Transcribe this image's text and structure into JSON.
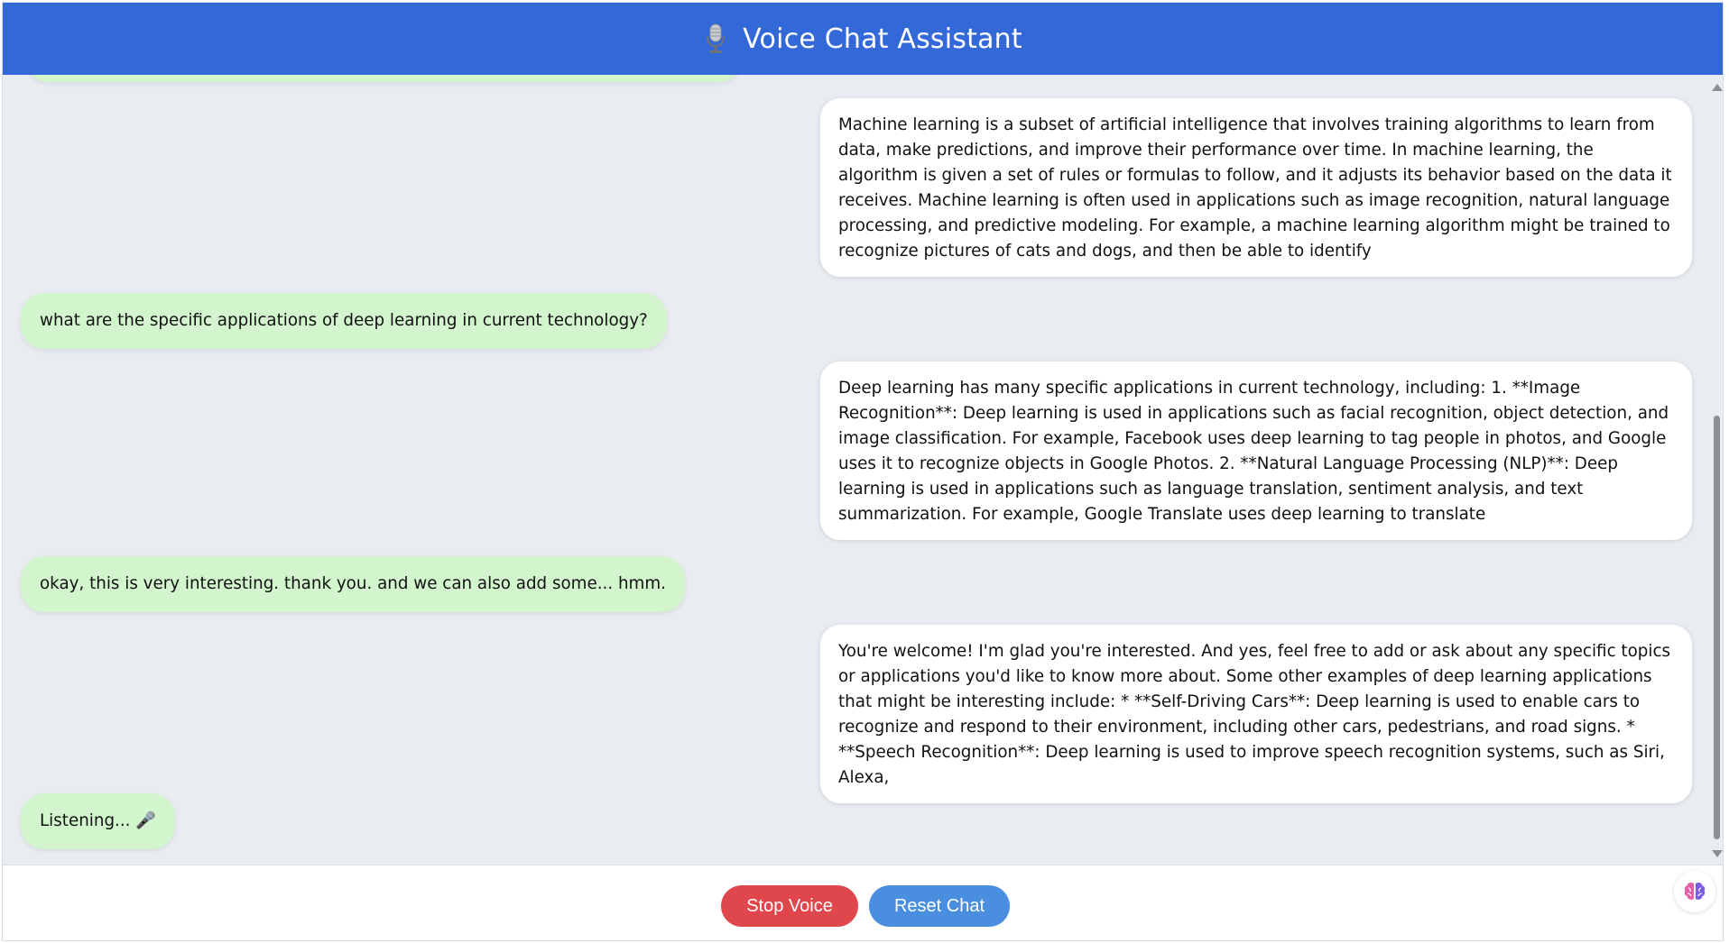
{
  "header": {
    "title": "Voice Chat Assistant",
    "icon": "studio-microphone-icon"
  },
  "messages": [
    {
      "role": "assistant",
      "text": "Machine learning is a subset of artificial intelligence that involves training algorithms to learn from data, make predictions, and improve their performance over time. In machine learning, the algorithm is given a set of rules or formulas to follow, and it adjusts its behavior based on the data it receives. Machine learning is often used in applications such as image recognition, natural language processing, and predictive modeling. For example, a machine learning algorithm might be trained to recognize pictures of cats and dogs, and then be able to identify"
    },
    {
      "role": "user",
      "text": "what are the specific applications of deep learning in current technology?"
    },
    {
      "role": "assistant",
      "text": "Deep learning has many specific applications in current technology, including: 1. **Image Recognition**: Deep learning is used in applications such as facial recognition, object detection, and image classification. For example, Facebook uses deep learning to tag people in photos, and Google uses it to recognize objects in Google Photos. 2. **Natural Language Processing (NLP)**: Deep learning is used in applications such as language translation, sentiment analysis, and text summarization. For example, Google Translate uses deep learning to translate"
    },
    {
      "role": "user",
      "text": "okay, this is very interesting. thank you. and we can also add some... hmm."
    },
    {
      "role": "assistant",
      "text": "You're welcome! I'm glad you're interested. And yes, feel free to add or ask about any specific topics or applications you'd like to know more about. Some other examples of deep learning applications that might be interesting include: * **Self-Driving Cars**: Deep learning is used to enable cars to recognize and respond to their environment, including other cars, pedestrians, and road signs. * **Speech Recognition**: Deep learning is used to improve speech recognition systems, such as Siri, Alexa,"
    },
    {
      "role": "user",
      "text": "Listening... 🎤"
    }
  ],
  "controls": {
    "stop_label": "Stop Voice",
    "reset_label": "Reset Chat"
  },
  "colors": {
    "header": "#3368d8",
    "user_bubble": "#d3f5cd",
    "assistant_bubble": "#ffffff",
    "chat_background": "#e9edf2",
    "stop_button": "#e0474c",
    "reset_button": "#4a8ee0"
  },
  "widget_icon": "brain-icon"
}
